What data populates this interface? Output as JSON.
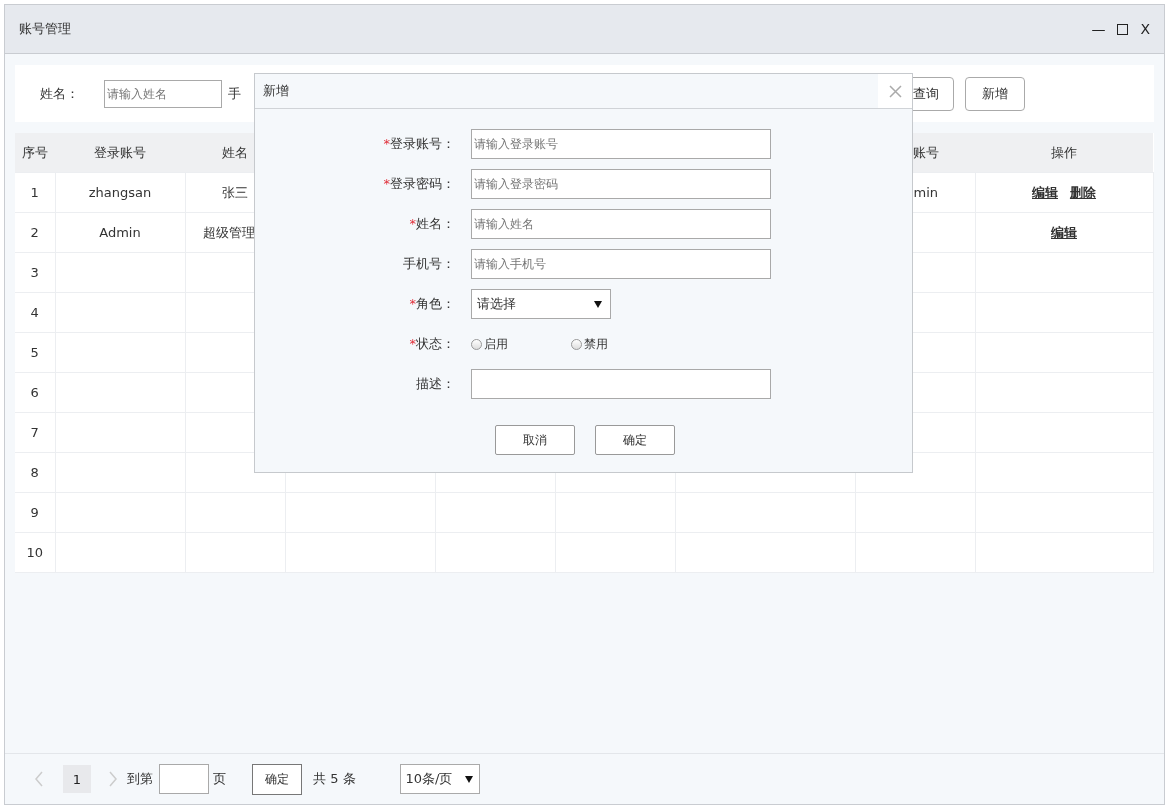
{
  "window": {
    "title": "账号管理",
    "minimize": "—",
    "close": "X"
  },
  "search": {
    "fields": [
      {
        "label": "姓名：",
        "placeholder": "请输入姓名"
      }
    ],
    "cut_label": "手",
    "buttons": [
      {
        "kind": "partial",
        "label": "查询"
      },
      {
        "kind": "full",
        "label": "新增"
      }
    ]
  },
  "table": {
    "columns": [
      {
        "header": "序号"
      },
      {
        "header": "登录账号"
      },
      {
        "header": "姓名"
      },
      {},
      {},
      {},
      {},
      {
        "header": "账号",
        "kind": "partial"
      },
      {
        "header": "操作"
      }
    ],
    "rows": [
      {
        "number": "1",
        "login": "zhangsan",
        "name": "张三",
        "column_8": "min",
        "actions": [
          "编辑",
          "删除"
        ]
      },
      {
        "number": "2",
        "login": "Admin",
        "name": "超级管理",
        "actions": [
          "编辑"
        ]
      },
      {
        "number": "3"
      },
      {
        "number": "4"
      },
      {
        "number": "5"
      },
      {
        "number": "6"
      },
      {
        "number": "7"
      },
      {
        "number": "8"
      },
      {
        "number": "9"
      },
      {
        "number": "10"
      }
    ]
  },
  "dialog": {
    "title": "新增",
    "fields": [
      {
        "kind": "text",
        "required_mark": "*",
        "label": "登录账号：",
        "placeholder": "请输入登录账号"
      },
      {
        "kind": "text",
        "required_mark": "*",
        "label": "登录密码：",
        "placeholder": "请输入登录密码"
      },
      {
        "kind": "text",
        "required_mark": "*",
        "label": "姓名：",
        "placeholder": "请输入姓名"
      },
      {
        "kind": "text",
        "label": "手机号：",
        "placeholder": "请输入手机号"
      },
      {
        "kind": "select",
        "required_mark": "*",
        "label": "角色：",
        "value": "请选择"
      },
      {
        "kind": "radio",
        "required_mark": "*",
        "label": "状态：",
        "options": [
          {
            "label": "启用",
            "selected": false
          },
          {
            "label": "禁用",
            "selected": false
          }
        ]
      },
      {
        "kind": "text",
        "label": "描述："
      }
    ],
    "buttons": [
      "取消",
      "确定"
    ]
  },
  "pagination": {
    "pages": [
      {
        "label": "1",
        "selected": true
      }
    ],
    "goto_label": "到第",
    "page_unit": "页",
    "confirm": "确定",
    "total": "共 5 条",
    "page_size": "10条/页"
  }
}
